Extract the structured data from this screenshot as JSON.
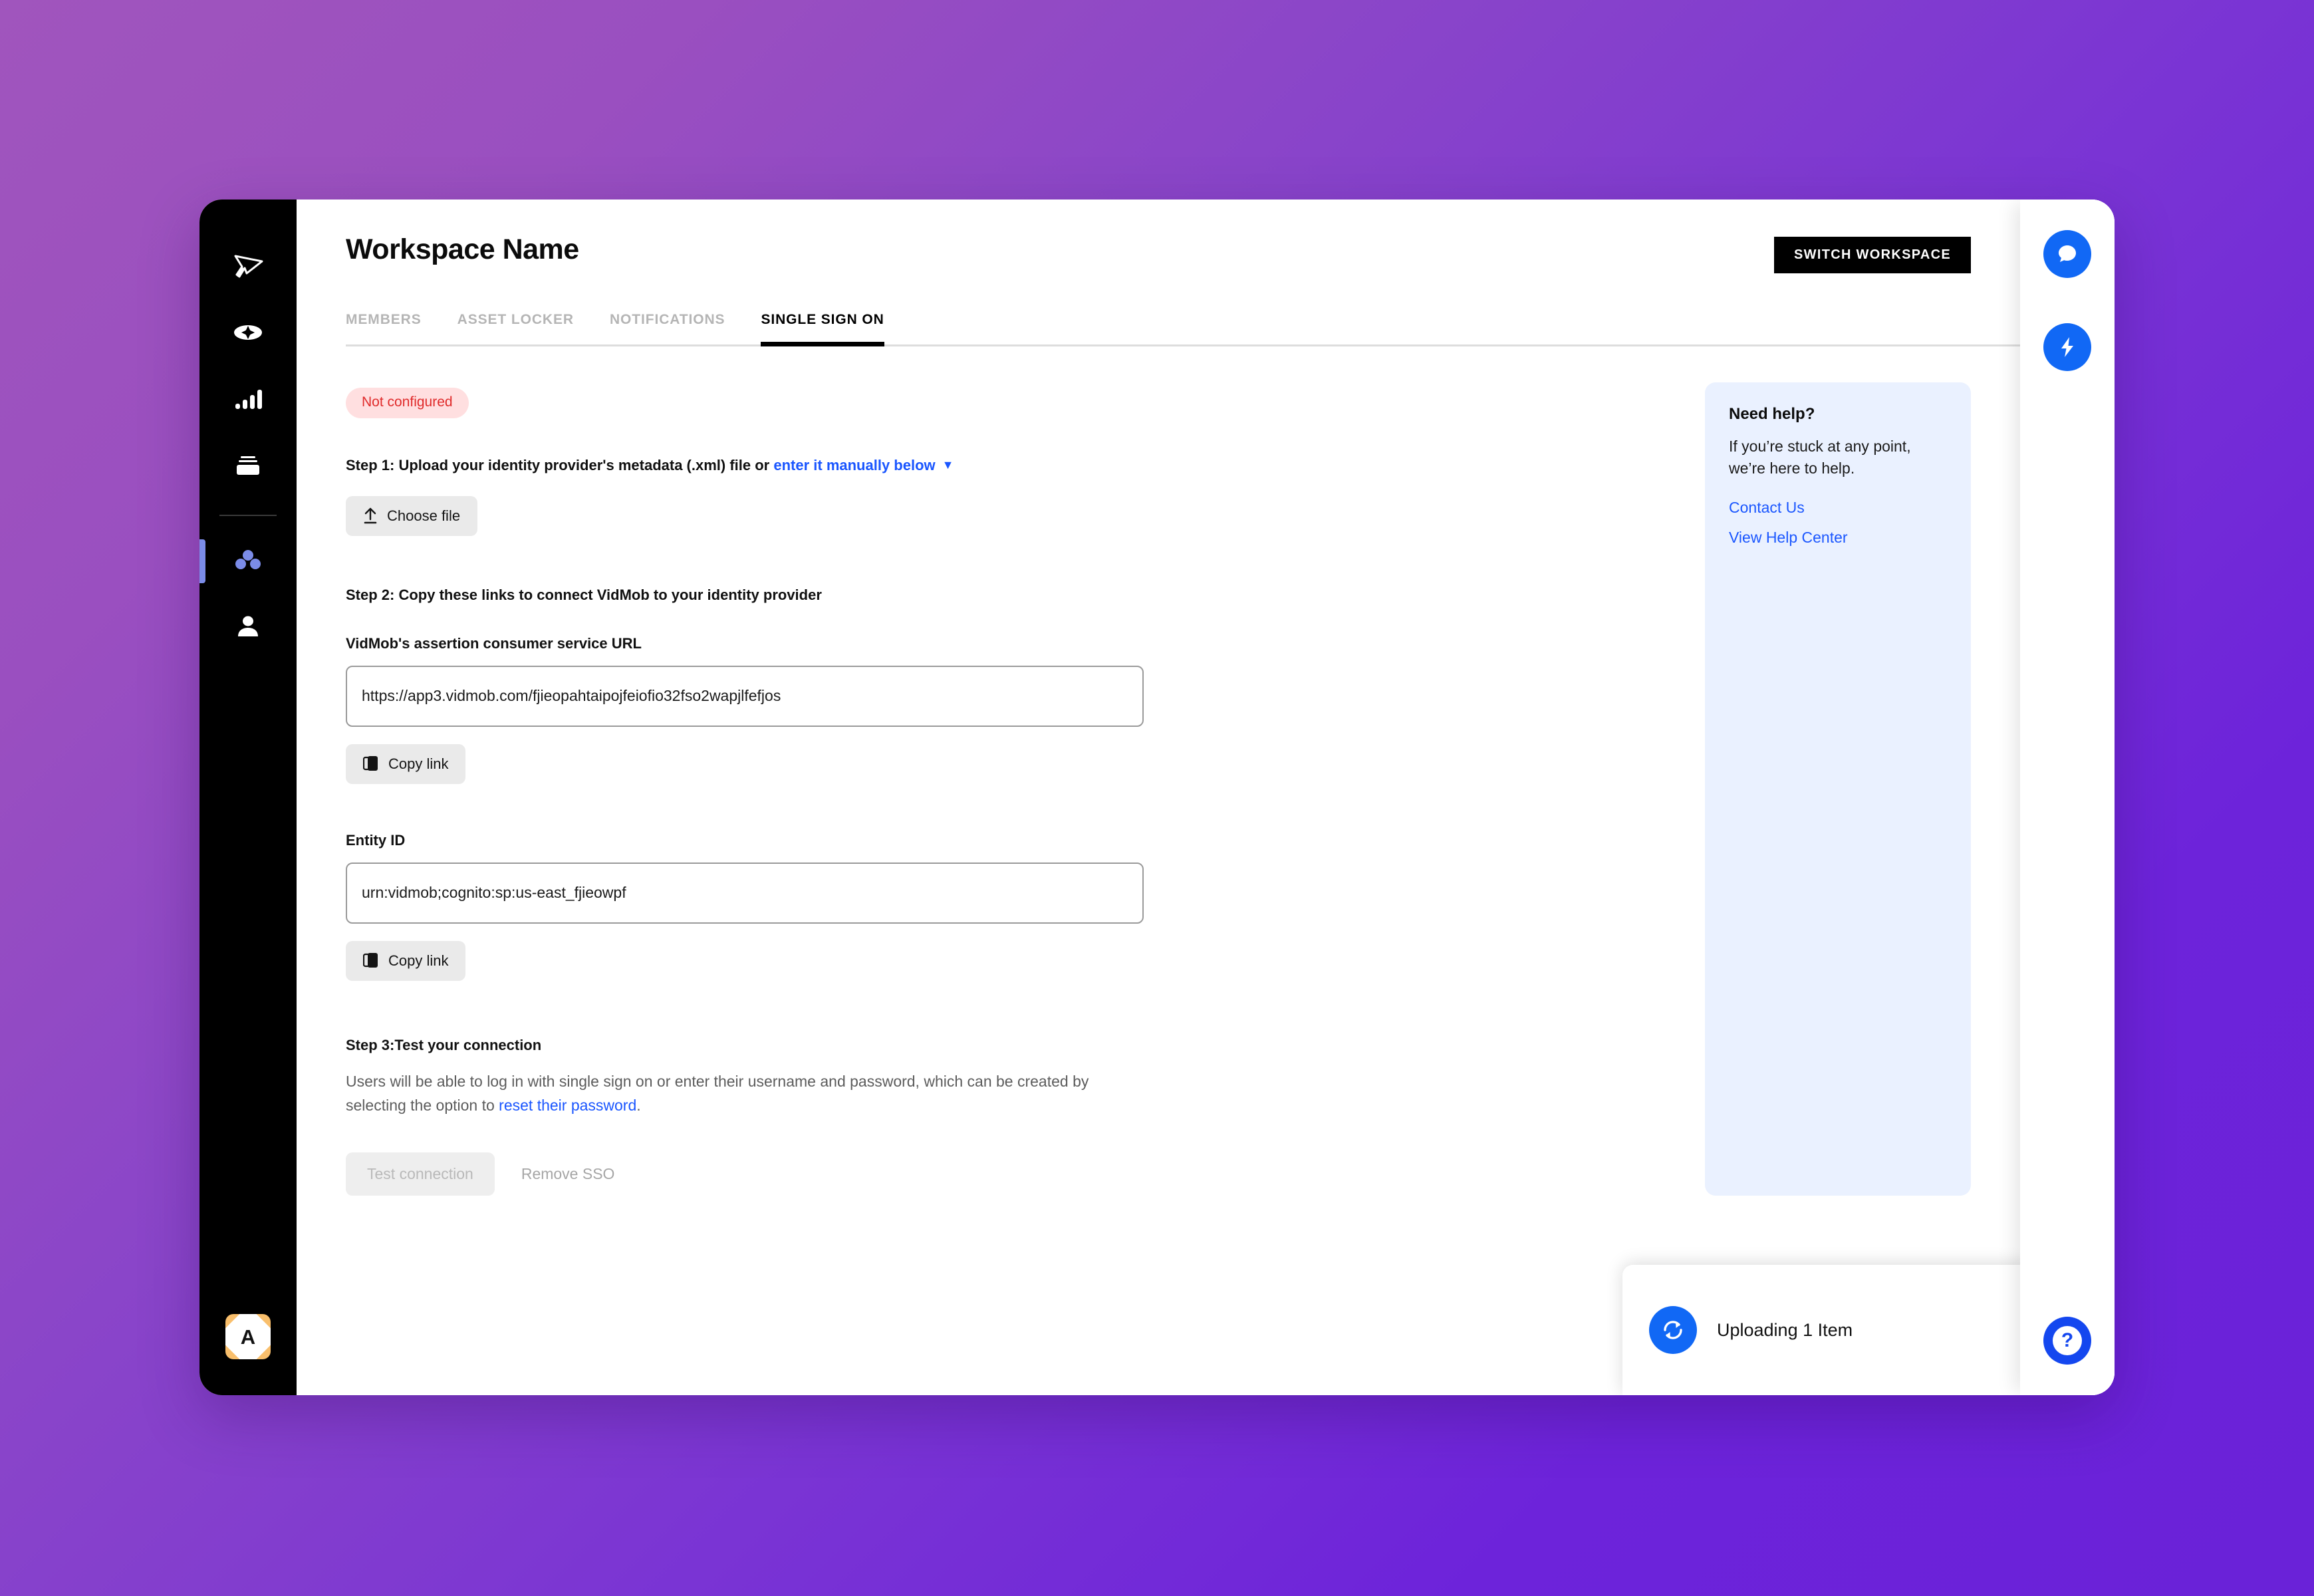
{
  "window": {
    "title": "Workspace Name"
  },
  "sidebar": {
    "items": [
      {
        "icon": "cursor-logo-icon",
        "label": "VidMob Logo"
      },
      {
        "icon": "sparkle-eye-icon",
        "label": "Create"
      },
      {
        "icon": "bar-chart-icon",
        "label": "Analytics"
      },
      {
        "icon": "archive-box-icon",
        "label": "Library"
      },
      {
        "icon": "team-dots-icon",
        "label": "Workspace",
        "active": true
      },
      {
        "icon": "person-icon",
        "label": "Account"
      }
    ],
    "avatar_letter": "A"
  },
  "header": {
    "title": "Workspace Name",
    "switch_workspace_label": "SWITCH WORKSPACE"
  },
  "tabs": [
    {
      "label": "MEMBERS",
      "active": false
    },
    {
      "label": "ASSET LOCKER",
      "active": false
    },
    {
      "label": "NOTIFICATIONS",
      "active": false
    },
    {
      "label": "SINGLE SIGN ON",
      "active": true
    }
  ],
  "sso": {
    "status_badge": "Not configured",
    "step1": {
      "text_before_link": "Step 1: Upload your identity provider's metadata (.xml) file or ",
      "link_text": "enter it manually below",
      "caret": "▼",
      "choose_file_label": "Choose file"
    },
    "step2": {
      "heading": "Step 2: Copy these links to connect VidMob to your identity provider",
      "acs_label": "VidMob's assertion consumer service URL",
      "acs_value": "https://app3.vidmob.com/fjieopahtaipojfeiofio32fso2wapjlfefjos",
      "acs_copy_label": "Copy link",
      "entity_label": "Entity ID",
      "entity_value": "urn:vidmob;cognito:sp:us-east_fjieowpf",
      "entity_copy_label": "Copy link"
    },
    "step3": {
      "heading": "Step 3:Test your connection",
      "body_before_link": "Users will be able to log in with single sign on or enter their username and password, which can be created by selecting the option to ",
      "link_text": "reset their password",
      "body_after_link": ".",
      "test_connection_label": "Test connection",
      "remove_sso_label": "Remove SSO"
    }
  },
  "need_help": {
    "title": "Need help?",
    "text": "If you’re stuck at any point, we’re here to help.",
    "contact_label": "Contact Us",
    "help_center_label": "View Help Center"
  },
  "upload_toast": {
    "label": "Uploading 1 Item",
    "spinner_icon": "refresh-icon",
    "collapse_icon": "chevron-up-icon"
  },
  "right_rail": {
    "chat_label": "Chat",
    "activity_label": "Activity",
    "help_label": "Help"
  },
  "colors": {
    "accent_blue": "#1a56ff",
    "brand_blue": "#1168f5",
    "badge_bg": "#ffdfe0",
    "badge_text": "#e02a2a",
    "sidebar_bg": "#000000",
    "active_indicator": "#7b8ce8",
    "help_card_bg": "#eaf1ff",
    "avatar_bg": "#f9bf6c",
    "bg_gradient_start": "#a055bd",
    "bg_gradient_end": "#6a22d8"
  }
}
